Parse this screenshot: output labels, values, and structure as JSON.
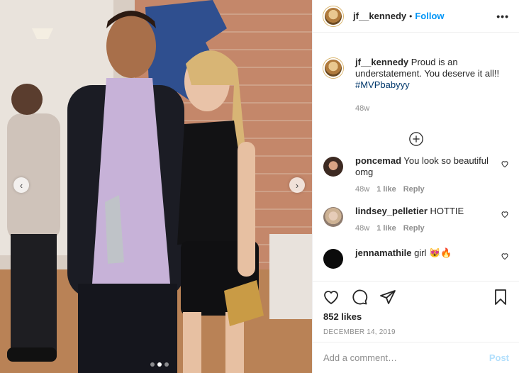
{
  "header": {
    "username": "jf__kennedy",
    "separator": "•",
    "follow_label": "Follow",
    "more_label": "•••"
  },
  "caption": {
    "username": "jf__kennedy",
    "text": "Proud is an understatement. You deserve it all!!",
    "hashtag": "#MVPbabyyy",
    "age": "48w"
  },
  "comments": [
    {
      "username": "poncemad",
      "text": "You look so beautiful omg",
      "age": "48w",
      "likes": "1 like",
      "reply_label": "Reply"
    },
    {
      "username": "lindsey_pelletier",
      "text": "HOTTIE",
      "age": "48w",
      "likes": "1 like",
      "reply_label": "Reply"
    },
    {
      "username": "jennamathile",
      "text": "girl 😻🔥"
    }
  ],
  "likes": "852 likes",
  "date": "DECEMBER 14, 2019",
  "comment_input": {
    "placeholder": "Add a comment…",
    "post_label": "Post"
  },
  "carousel": {
    "prev_icon": "‹",
    "next_icon": "›",
    "slide_count": 3,
    "active_index": 1
  },
  "colors": {
    "link": "#0095f6",
    "hashtag": "#00376b",
    "muted": "#8e8e8e",
    "post_disabled": "#b2dffc",
    "border": "#efefef"
  }
}
